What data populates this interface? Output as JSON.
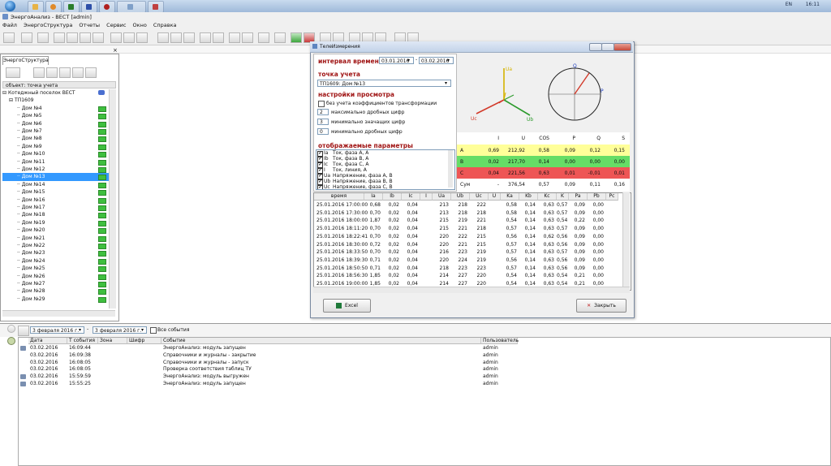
{
  "taskbar": {
    "lang": "EN",
    "time": "16:11"
  },
  "window": {
    "title": "ЭнергоАнализ - ВЕСТ [admin]"
  },
  "menu": [
    "Файл",
    "ЭнергоСтруктура",
    "Отчеты",
    "Сервис",
    "Окно",
    "Справка"
  ],
  "left": {
    "tab": "ЭнергоСтруктура",
    "object_label": "объект: точка учета",
    "root": "Котеджный поселок ВЕСТ",
    "substation": "ТП1609",
    "items": [
      "Дом №4",
      "Дом №5",
      "Дом №6",
      "Дом №7",
      "Дом №8",
      "Дом №9",
      "Дом №10",
      "Дом №11",
      "Дом №12",
      "Дом №13",
      "Дом №14",
      "Дом №15",
      "Дом №16",
      "Дом №17",
      "Дом №18",
      "Дом №19",
      "Дом №20",
      "Дом №21",
      "Дом №22",
      "Дом №23",
      "Дом №24",
      "Дом №25",
      "Дом №26",
      "Дом №27",
      "Дом №28",
      "Дом №29"
    ],
    "selected": "Дом №13"
  },
  "dialog": {
    "title": "ТелеИзмерения",
    "interval_label": "интервал времени",
    "date_from": "03.01.2016",
    "date_to": "03.02.2016",
    "point_label": "точка учета",
    "point_value": "ТП1609: Дом №13",
    "view_label": "настройки просмотра",
    "opt_no_coef": "без учета коэффициентов трансформации",
    "opt_max_dec": "максимально дробных цифр",
    "opt_min_sig": "минимально значащих цифр",
    "opt_min_dec": "минимально дробных цифр",
    "spin_max_dec": "2",
    "spin_min_sig": "3",
    "spin_min_dec": "0",
    "params_label": "отображаемые параметры",
    "params": [
      {
        "code": "Ia",
        "name": "Ток, фаза A, А"
      },
      {
        "code": "Ib",
        "name": "Ток, фаза B, А"
      },
      {
        "code": "Ic",
        "name": "Ток, фаза C, А"
      },
      {
        "code": "I",
        "name": "Ток, линия, А"
      },
      {
        "code": "Ua",
        "name": "Напряжение, фаза A, В"
      },
      {
        "code": "Ub",
        "name": "Напряжение, фаза B, В"
      },
      {
        "code": "Uc",
        "name": "Напряжение, фаза C, В"
      }
    ],
    "vector_labels": {
      "ua": "Ua",
      "ub": "Ub",
      "uc": "Uc",
      "q": "Q",
      "p": "P"
    },
    "summary": {
      "headers": [
        "I",
        "U",
        "COS",
        "P",
        "Q",
        "S"
      ],
      "rows": [
        {
          "label": "A",
          "color": "#ffff99",
          "values": [
            "0,69",
            "212,92",
            "0,58",
            "0,09",
            "0,12",
            "0,15"
          ]
        },
        {
          "label": "B",
          "color": "#66dd66",
          "values": [
            "0,02",
            "217,70",
            "0,14",
            "0,00",
            "0,00",
            "0,00"
          ]
        },
        {
          "label": "C",
          "color": "#ee5555",
          "values": [
            "0,04",
            "221,56",
            "0,63",
            "0,01",
            "-0,01",
            "0,01"
          ]
        },
        {
          "label": "Сум",
          "color": "#ffffff",
          "values": [
            "-",
            "376,54",
            "0,57",
            "0,09",
            "0,11",
            "0,16"
          ]
        }
      ]
    },
    "table": {
      "headers": [
        "время",
        "Ia",
        "Ib",
        "Ic",
        "I",
        "Ua",
        "Ub",
        "Uc",
        "U",
        "Ka",
        "Kb",
        "Kc",
        "K",
        "Pa",
        "Pb",
        "Pc"
      ],
      "rows": [
        [
          "25.01.2016 17:00:00",
          "0,68",
          "0,02",
          "0,04",
          "",
          "213",
          "218",
          "222",
          "",
          "0,58",
          "0,14",
          "0,63",
          "0,57",
          "0,09",
          "0,00",
          ""
        ],
        [
          "25.01.2016 17:30:00",
          "0,70",
          "0,02",
          "0,04",
          "",
          "213",
          "218",
          "218",
          "",
          "0,58",
          "0,14",
          "0,63",
          "0,57",
          "0,09",
          "0,00",
          ""
        ],
        [
          "25.01.2016 18:00:00",
          "1,87",
          "0,02",
          "0,04",
          "",
          "215",
          "219",
          "221",
          "",
          "0,54",
          "0,14",
          "0,63",
          "0,54",
          "0,22",
          "0,00",
          ""
        ],
        [
          "25.01.2016 18:11:20",
          "0,70",
          "0,02",
          "0,04",
          "",
          "215",
          "221",
          "218",
          "",
          "0,57",
          "0,14",
          "0,63",
          "0,57",
          "0,09",
          "0,00",
          ""
        ],
        [
          "25.01.2016 18:22:41",
          "0,70",
          "0,02",
          "0,04",
          "",
          "220",
          "222",
          "215",
          "",
          "0,56",
          "0,14",
          "0,62",
          "0,56",
          "0,09",
          "0,00",
          ""
        ],
        [
          "25.01.2016 18:30:00",
          "0,72",
          "0,02",
          "0,04",
          "",
          "220",
          "221",
          "215",
          "",
          "0,57",
          "0,14",
          "0,63",
          "0,56",
          "0,09",
          "0,00",
          ""
        ],
        [
          "25.01.2016 18:33:50",
          "0,70",
          "0,02",
          "0,04",
          "",
          "216",
          "223",
          "219",
          "",
          "0,57",
          "0,14",
          "0,63",
          "0,57",
          "0,09",
          "0,00",
          ""
        ],
        [
          "25.01.2016 18:39:30",
          "0,71",
          "0,02",
          "0,04",
          "",
          "220",
          "224",
          "219",
          "",
          "0,56",
          "0,14",
          "0,63",
          "0,56",
          "0,09",
          "0,00",
          ""
        ],
        [
          "25.01.2016 18:50:50",
          "0,71",
          "0,02",
          "0,04",
          "",
          "218",
          "223",
          "223",
          "",
          "0,57",
          "0,14",
          "0,63",
          "0,56",
          "0,09",
          "0,00",
          ""
        ],
        [
          "25.01.2016 18:56:30",
          "1,85",
          "0,02",
          "0,04",
          "",
          "214",
          "227",
          "220",
          "",
          "0,54",
          "0,14",
          "0,63",
          "0,54",
          "0,21",
          "0,00",
          ""
        ],
        [
          "25.01.2016 19:00:00",
          "1,85",
          "0,02",
          "0,04",
          "",
          "214",
          "227",
          "220",
          "",
          "0,54",
          "0,14",
          "0,63",
          "0,54",
          "0,21",
          "0,00",
          ""
        ]
      ]
    },
    "excel_label": "Excel",
    "close_label": "Закрыть"
  },
  "bottom": {
    "date_from": "3 февраля 2016 г.",
    "date_to": "3 февраля 2016 г.",
    "all_events": "Все события",
    "headers": [
      "Дата",
      "Т события",
      "Зона",
      "Шифр",
      "Событие",
      "Пользователь"
    ],
    "rows": [
      [
        "03.02.2016",
        "16:09:44",
        "",
        "",
        "ЭнергоАнализ: модуль запущен",
        "admin"
      ],
      [
        "03.02.2016",
        "16:09:38",
        "",
        "",
        "Справочники и журналы - закрытие",
        "admin"
      ],
      [
        "03.02.2016",
        "16:08:05",
        "",
        "",
        "Справочники и журналы - запуск",
        "admin"
      ],
      [
        "03.02.2016",
        "16:08:05",
        "",
        "",
        "Проверка соответствия таблиц ТУ",
        "admin"
      ],
      [
        "03.02.2016",
        "15:59:59",
        "",
        "",
        "ЭнергоАнализ: модуль выгружен",
        "admin"
      ],
      [
        "03.02.2016",
        "15:55:25",
        "",
        "",
        "ЭнергоАнализ: модуль запущен",
        "admin"
      ]
    ]
  }
}
